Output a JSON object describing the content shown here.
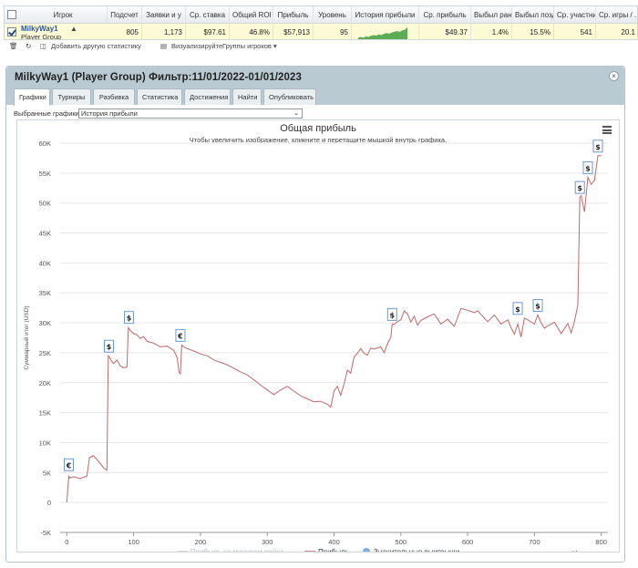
{
  "stats_table": {
    "headers": [
      "Игрок",
      "Подсчет",
      "Заявки и у",
      "Ср. ставка",
      "Общий ROI",
      "Прибыль",
      "Уровень",
      "История прибыли",
      "Ср. прибыль",
      "Выбыл ран",
      "Выбыл позд",
      "Ср. участни",
      "Ср. игры / ."
    ],
    "row": {
      "player_name": "MilkyWay1",
      "player_sub": "Player Group",
      "count": "805",
      "entries": "1,173",
      "avg_stake": "$97.61",
      "roi": "46.8%",
      "profit": "$57,913",
      "level": "95",
      "avg_profit": "$49.37",
      "early_out": "1.4%",
      "late_out": "15.5%",
      "avg_entrants": "541",
      "games_per": "20.1"
    }
  },
  "toolbar": {
    "add_stat": "Добавить другую статистику",
    "visualize": "Визуализируйте",
    "groups": "Группы игроков"
  },
  "panel": {
    "title": "MilkyWay1 (Player Group) Фильтр:11/01/2022-01/01/2023",
    "tabs": [
      "Графики",
      "Турниры",
      "Разбивка",
      "Статистика",
      "Достижения",
      "Найти",
      "Опубликовать"
    ],
    "active_tab": "Графики",
    "select_label": "Выбранные графики:",
    "select_value": "История прибыли"
  },
  "colors": {
    "line": "#c0686a",
    "marker_border": "#6a9ad6",
    "spark": "#5aad54",
    "legend_dot": "#7cb0e6"
  },
  "chart_data": {
    "type": "line",
    "title": "Общая прибыль",
    "subtitle": "Чтобы увеличить изображение, кликните и перетащите мышкой внутрь графика.",
    "ylabel": "Суммарный итог (USD)",
    "xlabel": "Номер игры",
    "xlim": [
      -10,
      810
    ],
    "ylim": [
      -5000,
      60000
    ],
    "x_ticks": [
      0,
      100,
      200,
      300,
      400,
      500,
      600,
      700,
      800
    ],
    "y_ticks": [
      -5000,
      0,
      5000,
      10000,
      15000,
      20000,
      25000,
      30000,
      35000,
      40000,
      45000,
      50000,
      55000,
      60000
    ],
    "y_tick_labels": [
      "-5K",
      "0",
      "5K",
      "10K",
      "15K",
      "20K",
      "25K",
      "30K",
      "35K",
      "40K",
      "45K",
      "50K",
      "55K",
      "60K"
    ],
    "legend": [
      "Прибыль за минусом рейка",
      "Прибыль",
      "Значительные выигрыши"
    ],
    "series": [
      {
        "name": "Прибыль",
        "x": [
          0,
          3,
          4,
          10,
          20,
          30,
          34,
          40,
          45,
          50,
          55,
          60,
          62,
          64,
          66,
          70,
          75,
          80,
          85,
          90,
          92,
          96,
          100,
          105,
          110,
          115,
          120,
          130,
          140,
          150,
          160,
          165,
          168,
          170,
          172,
          175,
          180,
          190,
          200,
          210,
          220,
          230,
          240,
          250,
          260,
          270,
          280,
          290,
          300,
          310,
          320,
          330,
          340,
          350,
          360,
          370,
          380,
          390,
          395,
          400,
          405,
          410,
          415,
          420,
          425,
          430,
          435,
          440,
          445,
          450,
          455,
          460,
          470,
          475,
          480,
          485,
          487,
          490,
          495,
          500,
          505,
          510,
          515,
          520,
          525,
          530,
          540,
          550,
          560,
          570,
          580,
          590,
          600,
          610,
          615,
          620,
          630,
          640,
          650,
          660,
          665,
          670,
          675,
          680,
          685,
          690,
          700,
          705,
          710,
          715,
          720,
          730,
          740,
          750,
          755,
          760,
          765,
          768,
          770,
          775,
          780,
          785,
          790,
          795,
          800
        ],
        "y": [
          0,
          4500,
          4100,
          4300,
          4000,
          4400,
          7500,
          7800,
          7200,
          6500,
          5800,
          5400,
          24500,
          24200,
          23800,
          23200,
          23800,
          22800,
          22500,
          22600,
          29200,
          28600,
          28200,
          28000,
          27400,
          27700,
          26900,
          26600,
          26000,
          26100,
          25400,
          24200,
          21700,
          21500,
          26300,
          26000,
          25700,
          25300,
          24800,
          24500,
          23800,
          23400,
          23000,
          22400,
          21800,
          21300,
          20500,
          19600,
          18800,
          18000,
          18800,
          19400,
          18600,
          17800,
          17300,
          16800,
          16900,
          16400,
          15900,
          18600,
          19400,
          17900,
          19800,
          22100,
          21600,
          24300,
          24900,
          25700,
          24900,
          24600,
          25800,
          25600,
          26000,
          25000,
          26500,
          27600,
          29800,
          29700,
          30200,
          30500,
          32000,
          31500,
          30100,
          31100,
          29600,
          30400,
          31000,
          31500,
          29800,
          30600,
          29400,
          32400,
          32100,
          31700,
          32000,
          31400,
          30200,
          31300,
          29800,
          30500,
          29200,
          28100,
          29800,
          27600,
          30800,
          30500,
          29800,
          31300,
          30000,
          29100,
          29500,
          30100,
          28200,
          29900,
          28300,
          30300,
          33000,
          51000,
          51200,
          48500,
          54300,
          53100,
          53800,
          57900,
          57900
        ]
      }
    ],
    "big_wins": [
      {
        "x": 3,
        "y": 4700,
        "symbol": "€"
      },
      {
        "x": 63,
        "y": 24500,
        "symbol": "$"
      },
      {
        "x": 93,
        "y": 29300,
        "symbol": "$"
      },
      {
        "x": 170,
        "y": 26300,
        "symbol": "€"
      },
      {
        "x": 487,
        "y": 29800,
        "symbol": "$"
      },
      {
        "x": 675,
        "y": 30800,
        "symbol": "$"
      },
      {
        "x": 705,
        "y": 31300,
        "symbol": "$"
      },
      {
        "x": 768,
        "y": 51000,
        "symbol": "$"
      },
      {
        "x": 780,
        "y": 54300,
        "symbol": "$"
      },
      {
        "x": 795,
        "y": 57900,
        "symbol": "$"
      }
    ],
    "grid": true,
    "legend_position": "bottom"
  },
  "sparkline": [
    2,
    3,
    2,
    4,
    3,
    5,
    6,
    5,
    7,
    6,
    8,
    9,
    8,
    10,
    11,
    12,
    11,
    13,
    14,
    18
  ]
}
